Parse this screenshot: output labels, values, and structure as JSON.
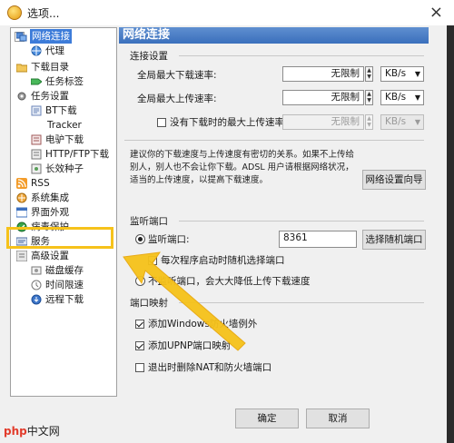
{
  "window": {
    "title": "选项..."
  },
  "tree": {
    "items": [
      {
        "label": "网络连接",
        "icon": "network-icon",
        "selected": true
      },
      {
        "label": "代理",
        "icon": "proxy-icon"
      },
      {
        "label": "下载目录",
        "icon": "folder-icon"
      },
      {
        "label": "任务标签",
        "icon": "tag-icon"
      },
      {
        "label": "任务设置",
        "icon": "task-settings-icon"
      },
      {
        "label": "BT下载",
        "icon": "bt-icon"
      },
      {
        "label": "Tracker",
        "icon": "tracker-icon"
      },
      {
        "label": "电驴下载",
        "icon": "emule-icon"
      },
      {
        "label": "HTTP/FTP下载",
        "icon": "http-ftp-icon"
      },
      {
        "label": "长效种子",
        "icon": "seed-icon"
      },
      {
        "label": "RSS",
        "icon": "rss-icon"
      },
      {
        "label": "系统集成",
        "icon": "integration-icon"
      },
      {
        "label": "界面外观",
        "icon": "appearance-icon"
      },
      {
        "label": "病毒保护",
        "icon": "virus-protect-icon"
      },
      {
        "label": "服务",
        "icon": "service-icon"
      },
      {
        "label": "高级设置",
        "icon": "advanced-icon"
      },
      {
        "label": "磁盘缓存",
        "icon": "disk-cache-icon"
      },
      {
        "label": "时间限速",
        "icon": "time-limit-icon"
      },
      {
        "label": "远程下载",
        "icon": "remote-download-icon"
      }
    ]
  },
  "panel": {
    "title": "网络连接",
    "connection": {
      "heading": "连接设置",
      "max_download_label": "全局最大下载速率:",
      "max_download_value": "无限制",
      "max_download_unit": "KB/s",
      "max_upload_label": "全局最大上传速率:",
      "max_upload_value": "无限制",
      "max_upload_unit": "KB/s",
      "no_task_label": "没有下载时的最大上传速率",
      "no_task_checked": false,
      "no_task_value": "无限制",
      "no_task_unit": "KB/s"
    },
    "advice": {
      "text": "建议你的下载速度与上传速度有密切的关系。如果不上传给别人，别人也不会让你下载。ADSL 用户请根据网络状况，适当的上传速度，以提高下载速度。",
      "wizard_button": "网络设置向导"
    },
    "listen": {
      "heading": "监听端口",
      "port_radio_label": "监听端口:",
      "port_value": "8361",
      "random_port_button": "选择随机端口",
      "random_each_start_label": "每次程序启动时随机选择端口",
      "random_each_start_checked": true,
      "auto_radio_label": "不监听端口，会大大降低上传下载速度",
      "auto_radio_short": "不监听端口，会大大降低上传下载速度"
    },
    "mapping": {
      "heading": "端口映射",
      "firewall_label": "添加Windows防火墙例外",
      "firewall_checked": true,
      "upnp_label": "添加UPNP端口映射",
      "upnp_checked": true,
      "remove_label": "退出时删除NAT和防火墙端口",
      "remove_checked": false
    }
  },
  "footer": {
    "ok_label": "确定",
    "cancel_label": "取消"
  },
  "watermark": {
    "brand_mark": "php",
    "text": "中文网"
  },
  "colors": {
    "banner": "#3a6fbc",
    "selection": "#3d7cd9",
    "annotation_arrow": "#f6c21a"
  }
}
